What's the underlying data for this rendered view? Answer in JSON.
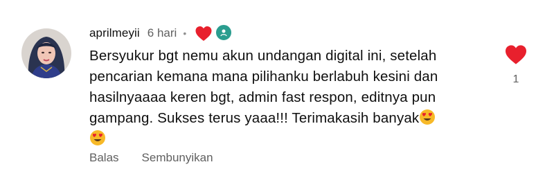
{
  "comment": {
    "author": "aprilmeyii",
    "time": "6 hari",
    "separator": "•",
    "text_lines": [
      "Bersyukur bgt nemu akun undangan digital ini, setelah",
      "pencarian kemana mana pilihanku berlabuh kesini dan",
      "hasilnyaaaa keren bgt, admin fast respon, editnya pun",
      "gampang. Sukses terus yaaa!!! Terimakasih banyak"
    ],
    "emoji": "heart-eyes",
    "like_count": "1",
    "reply_label": "Balas",
    "hide_label": "Sembunyikan"
  },
  "colors": {
    "heart": "#e8202d",
    "creator_badge": "#2a9d8f",
    "secondary_text": "#606060",
    "primary_text": "#0f0f0f",
    "emoji_face": "#f7b928",
    "emoji_eyes": "#e8202d"
  },
  "icons": {
    "creator_heart": "heart-icon",
    "like": "heart-icon",
    "creator_avatar": "creator-avatar-icon",
    "emoji": "heart-eyes-emoji-icon"
  }
}
